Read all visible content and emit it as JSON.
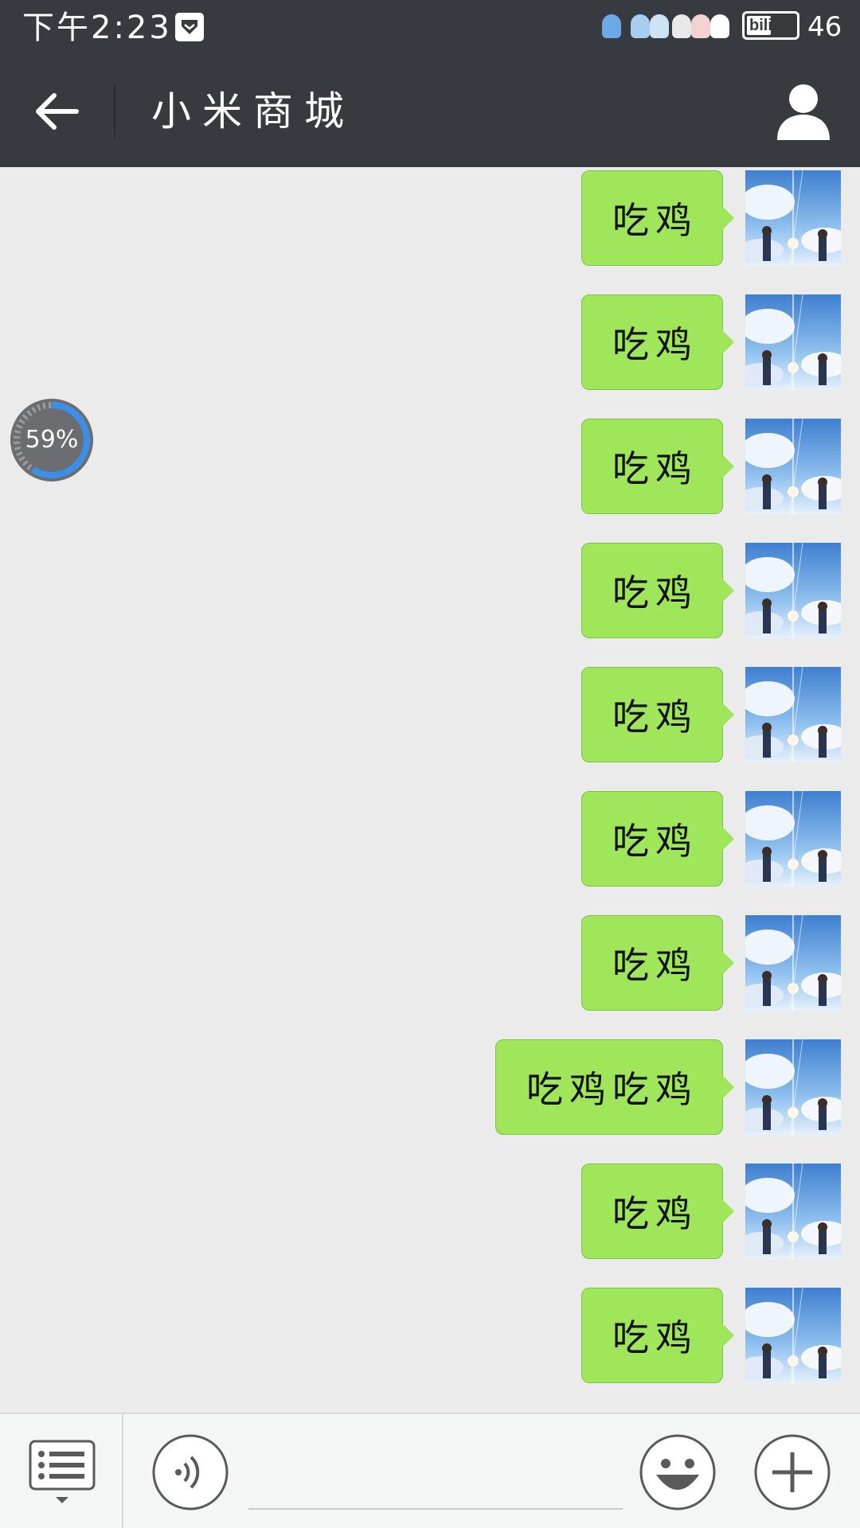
{
  "status_bar": {
    "time": "下午2:23",
    "battery_brand": "bili",
    "battery_level": "46",
    "icons": [
      "shield-icon",
      "mascot-icon",
      "sticker-icons",
      "battery-icon"
    ]
  },
  "header": {
    "title": "小米商城",
    "back_icon": "arrow-left-icon",
    "profile_icon": "person-icon"
  },
  "messages": [
    {
      "text": "吃鸡",
      "sender": "me"
    },
    {
      "text": "吃鸡",
      "sender": "me"
    },
    {
      "text": "吃鸡",
      "sender": "me"
    },
    {
      "text": "吃鸡",
      "sender": "me"
    },
    {
      "text": "吃鸡",
      "sender": "me"
    },
    {
      "text": "吃鸡",
      "sender": "me"
    },
    {
      "text": "吃鸡",
      "sender": "me"
    },
    {
      "text": "吃鸡吃鸡",
      "sender": "me"
    },
    {
      "text": "吃鸡",
      "sender": "me"
    },
    {
      "text": "吃鸡",
      "sender": "me"
    }
  ],
  "floating_meter": {
    "label": "59%",
    "value": 0.59
  },
  "bottom_bar": {
    "menu_icon": "list-menu-icon",
    "voice_icon": "voice-icon",
    "emoji_icon": "smiley-icon",
    "plus_icon": "plus-icon"
  },
  "colors": {
    "header_bg": "#373a3f",
    "chat_bg": "#ebebeb",
    "bubble": "#9fe65a",
    "bottom_bg": "#f4f5f5"
  }
}
